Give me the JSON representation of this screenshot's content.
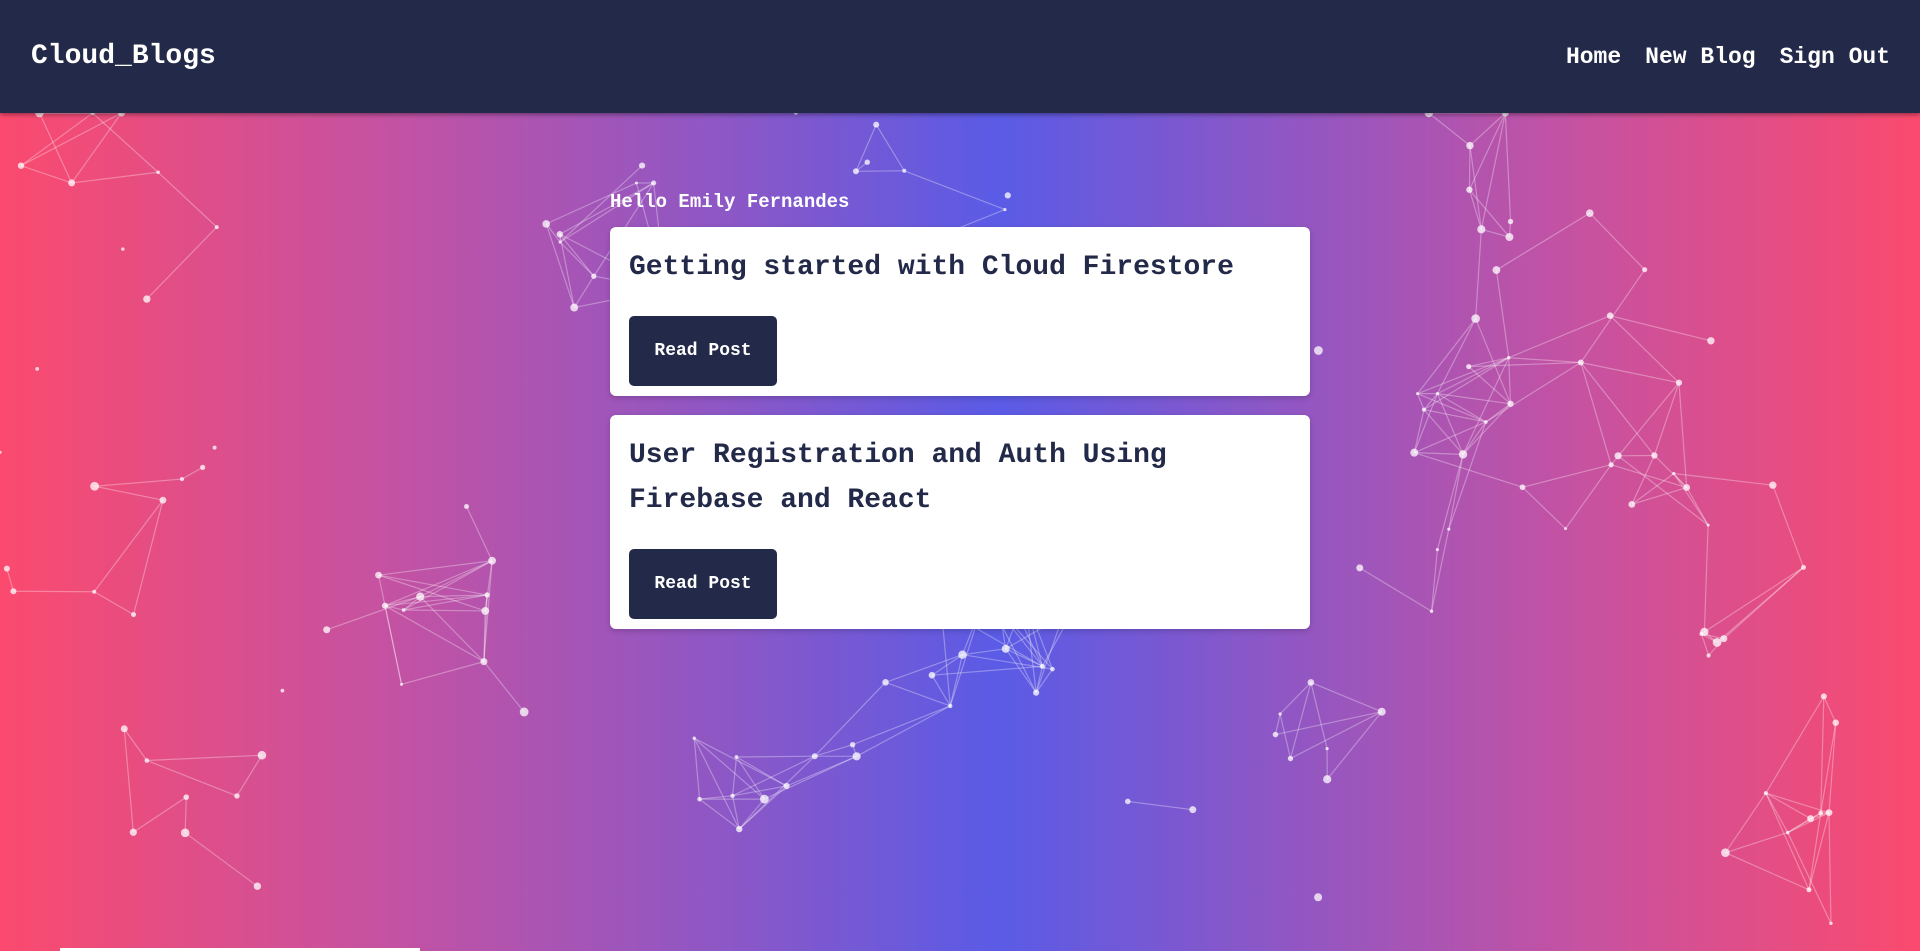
{
  "navbar": {
    "brand": "Cloud_Blogs",
    "links": [
      {
        "label": "Home"
      },
      {
        "label": "New Blog"
      },
      {
        "label": "Sign Out"
      }
    ]
  },
  "main": {
    "greeting": "Hello Emily Fernandes",
    "posts": [
      {
        "title": "Getting started with Cloud Firestore",
        "button_label": "Read Post"
      },
      {
        "title": "User Registration and Auth Using Firebase and React",
        "button_label": "Read Post"
      }
    ]
  },
  "colors": {
    "navbar_bg": "#232948",
    "gradient_edge": "#fb4a6e",
    "gradient_center": "#5a5be6",
    "button_bg": "#232948"
  }
}
